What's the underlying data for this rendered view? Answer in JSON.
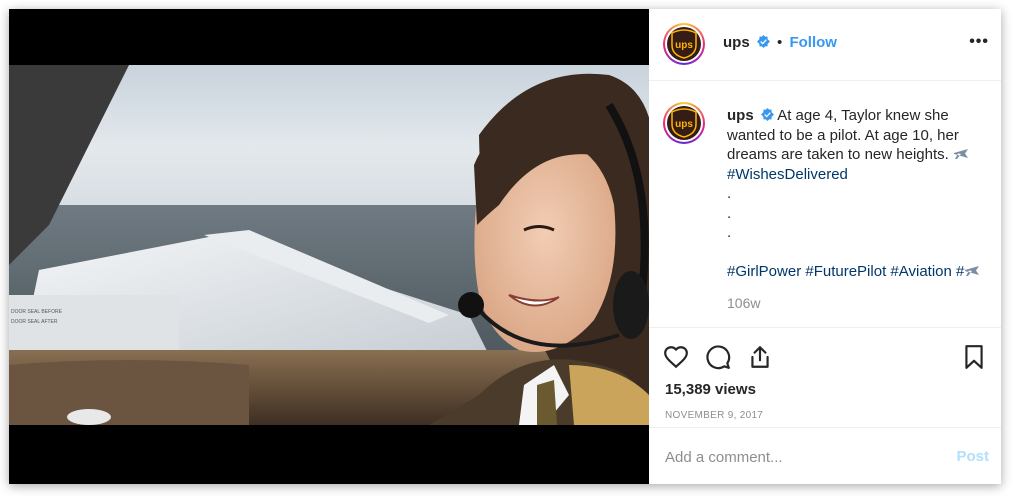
{
  "post": {
    "account": {
      "username": "ups",
      "verified": true,
      "follow_label": "Follow",
      "separator": "•",
      "more_label": "•••",
      "avatar_text": "ups"
    },
    "caption": {
      "username": "ups",
      "text_line1": "At age 4, Taylor knew she wanted to be a pilot. At age 10, her dreams are taken to new heights.",
      "hashtag1": "#WishesDelivered",
      "dots": [
        ".",
        ".",
        "."
      ],
      "hashtags2": [
        "#GirlPower",
        "#FuturePilot",
        "#Aviation",
        "#"
      ],
      "time_ago": "106w"
    },
    "stats": {
      "views": "15,389 views",
      "date": "NOVEMBER 9, 2017"
    },
    "comment": {
      "placeholder": "Add a comment...",
      "post_label": "Post"
    },
    "icons": [
      "heart-icon",
      "comment-icon",
      "share-icon",
      "bookmark-icon",
      "airplane-icon",
      "verified-badge-icon"
    ],
    "colors": {
      "link_blue": "#3897f0",
      "hashtag": "#00376b",
      "muted": "#8e8e8e",
      "post_disabled": "#b2dffc",
      "ups_brown": "#351c15",
      "ups_gold": "#ffb500"
    }
  }
}
